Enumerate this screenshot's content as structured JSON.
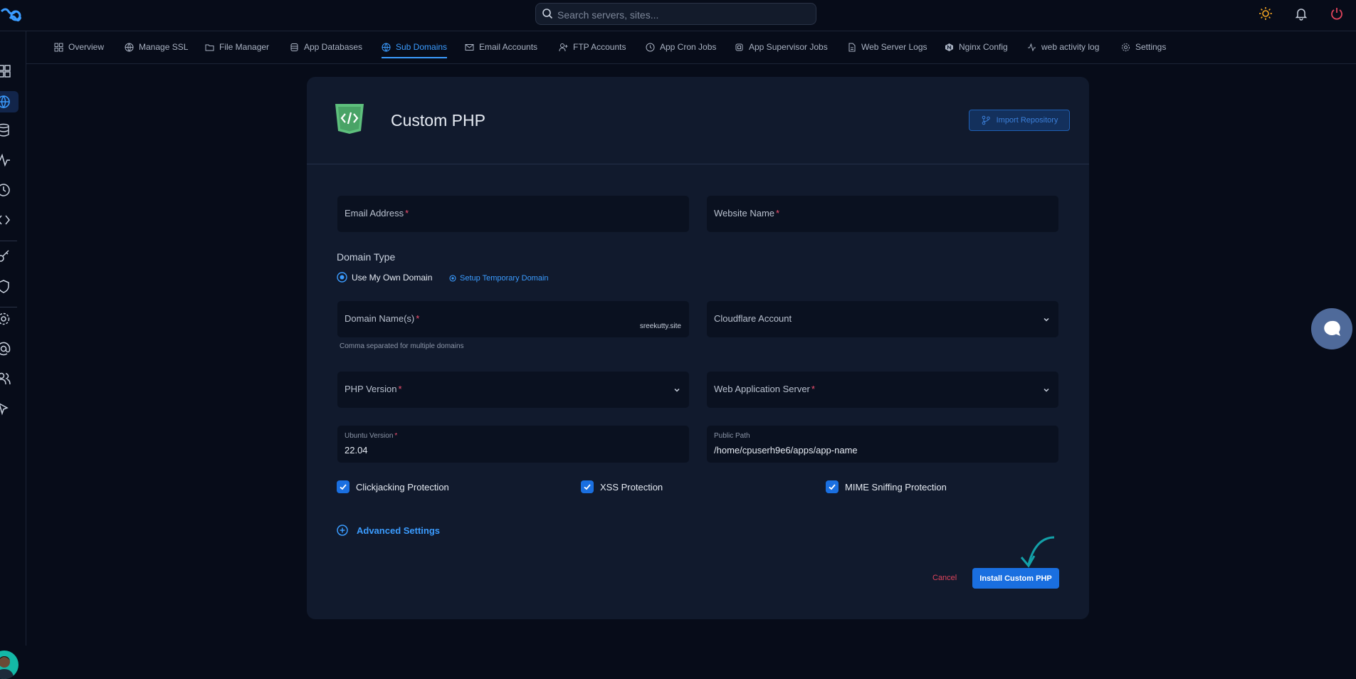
{
  "search": {
    "placeholder": "Search servers, sites..."
  },
  "nav_tabs": [
    {
      "label": "Overview",
      "icon": "grid-icon"
    },
    {
      "label": "Manage SSL",
      "icon": "globe-icon"
    },
    {
      "label": "File Manager",
      "icon": "folder-icon"
    },
    {
      "label": "App Databases",
      "icon": "database-icon"
    },
    {
      "label": "Sub Domains",
      "icon": "globe-icon",
      "active": true
    },
    {
      "label": "Email Accounts",
      "icon": "mail-icon"
    },
    {
      "label": "FTP Accounts",
      "icon": "user-plus-icon"
    },
    {
      "label": "App Cron Jobs",
      "icon": "clock-icon"
    },
    {
      "label": "App Supervisor Jobs",
      "icon": "chip-icon"
    },
    {
      "label": "Web Server Logs",
      "icon": "file-icon"
    },
    {
      "label": "Nginx Config",
      "icon": "nginx-icon"
    },
    {
      "label": "web activity log",
      "icon": "activity-icon"
    },
    {
      "label": "Settings",
      "icon": "gear-icon"
    }
  ],
  "card": {
    "title": "Custom PHP",
    "import_label": "Import Repository"
  },
  "form": {
    "email_label": "Email Address",
    "website_label": "Website Name",
    "required_mark": "*",
    "domain_type_label": "Domain Type",
    "own_domain_label": "Use My Own Domain",
    "temp_domain_label": "Setup Temporary Domain",
    "domain_names_label": "Domain Name(s)",
    "domain_suffix": "sreekutty.site",
    "domain_hint": "Comma separated for multiple domains",
    "cloudflare_label": "Cloudflare Account",
    "php_version_label": "PHP Version",
    "web_server_label": "Web Application Server",
    "ubuntu_label": "Ubuntu Version",
    "ubuntu_value": "22.04",
    "public_path_label": "Public Path",
    "public_path_value": "/home/cpuserh9e6/apps/app-name",
    "clickjacking_label": "Clickjacking Protection",
    "xss_label": "XSS Protection",
    "mime_label": "MIME Sniffing Protection",
    "advanced_label": "Advanced Settings",
    "cancel_label": "Cancel",
    "install_label": "Install Custom PHP"
  },
  "colors": {
    "accent": "#1a6fe0",
    "link": "#3b9cff",
    "danger": "#e0445c",
    "background": "#070c19",
    "card": "#111a2d"
  }
}
